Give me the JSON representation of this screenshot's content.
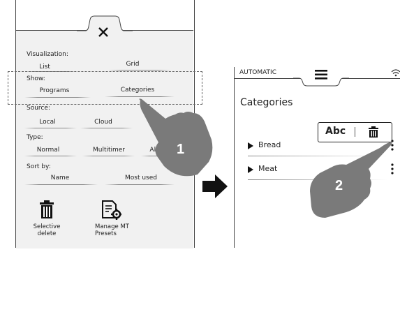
{
  "left_panel": {
    "close_icon": "close-icon",
    "visualization": {
      "label": "Visualization:",
      "options": [
        "List",
        "Grid"
      ]
    },
    "show": {
      "label": "Show:",
      "options": [
        "Programs",
        "Categories"
      ]
    },
    "source": {
      "label": "Source:",
      "options": [
        "Local",
        "Cloud"
      ]
    },
    "type": {
      "label": "Type:",
      "options": [
        "Normal",
        "Multitimer",
        "All"
      ]
    },
    "sort_by": {
      "label": "Sort by:",
      "options": [
        "Name",
        "Most used"
      ]
    },
    "actions": [
      {
        "label": "Selective\ndelete",
        "icon": "trash-icon"
      },
      {
        "label": "Manage MT\nPresets",
        "icon": "document-gear-icon"
      }
    ],
    "step_number": "1"
  },
  "arrow": {
    "icon": "right-arrow-icon"
  },
  "right_panel": {
    "mode_label": "AUTOMATIC",
    "menu_icon": "hamburger-icon",
    "wifi_icon": "wifi-icon",
    "title": "Categories",
    "popup": {
      "rename_label": "Abc",
      "delete_icon": "trash-icon"
    },
    "items": [
      {
        "label": "Bread"
      },
      {
        "label": "Meat"
      }
    ],
    "step_number": "2"
  }
}
